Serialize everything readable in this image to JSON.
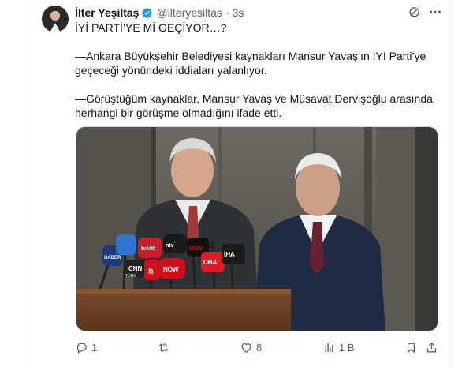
{
  "tweet": {
    "author_name": "İlter Yeşiltaş",
    "handle": "@ilteryesiltas",
    "separator": "·",
    "time": "3s",
    "lines": [
      "İYİ PARTİ’YE Mİ GEÇİYOR…?",
      "—Ankara Büyükşehir Belediyesi kaynakları Mansur Yavaş’ın İYİ Parti’ye geçeceği yönündeki iddiaları yalanlıyor.",
      "—Görüştüğüm kaynaklar, Mansur Yavaş ve Müsavat Dervişoğlu arasında herhangi bir görüşme olmadığını ifade etti."
    ]
  },
  "media": {
    "mic_labels": [
      "HABER",
      "TÜRK",
      "CNN",
      "h",
      "NOW",
      "DHA",
      "İHA",
      "NOW",
      "ntv",
      "tv100"
    ]
  },
  "actions": {
    "replies": "1",
    "reposts": "",
    "likes": "8",
    "views": "1 B"
  },
  "colors": {
    "verified": "#1d9bf0",
    "muted": "#536471",
    "text": "#0f1419"
  },
  "icons": [
    "verified-badge-icon",
    "grok-icon",
    "more-icon",
    "reply-icon",
    "repost-icon",
    "like-icon",
    "views-icon",
    "bookmark-icon",
    "share-icon"
  ]
}
